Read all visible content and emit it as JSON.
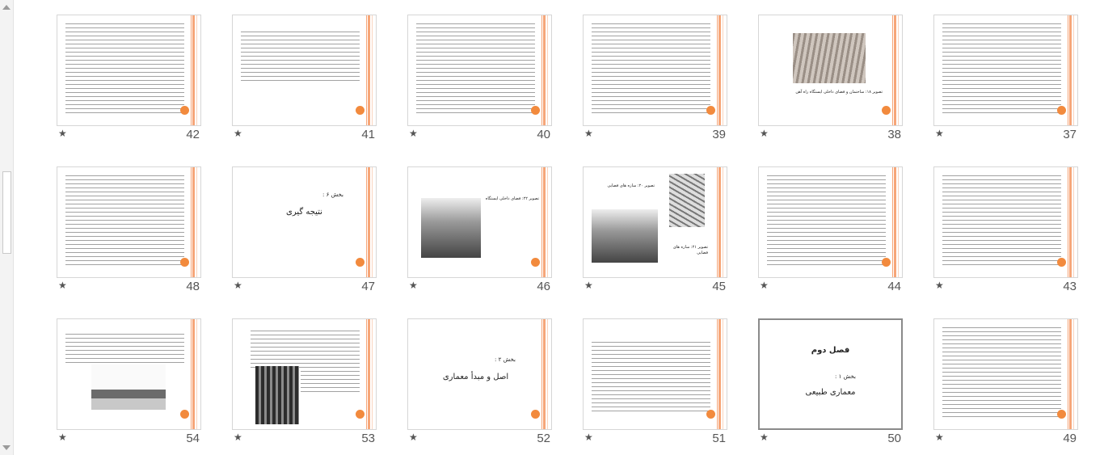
{
  "slides": [
    {
      "num": "37",
      "star": "★"
    },
    {
      "num": "38",
      "star": "★",
      "caption": "تصویر ۱۸: ساختمان و فضای داخلی ایستگاه راه آهن"
    },
    {
      "num": "39",
      "star": "★"
    },
    {
      "num": "40",
      "star": "★"
    },
    {
      "num": "41",
      "star": "★"
    },
    {
      "num": "42",
      "star": "★"
    },
    {
      "num": "43",
      "star": "★"
    },
    {
      "num": "44",
      "star": "★"
    },
    {
      "num": "45",
      "star": "★",
      "caption_top": "تصویر ۲۰: سازه های فضایی",
      "caption_bottom": "تصویر ۲۱: سازه های فضایی"
    },
    {
      "num": "46",
      "star": "★",
      "caption": "تصویر ۲۲: فضای داخلی ایستگاه"
    },
    {
      "num": "47",
      "star": "★",
      "label": "بخش ۶ :",
      "title": "نتیجه گیری"
    },
    {
      "num": "48",
      "star": "★"
    },
    {
      "num": "49",
      "star": "★"
    },
    {
      "num": "50",
      "star": "★",
      "chapter": "فصل دوم",
      "label": "بخش ۱ :",
      "title": "معماری طبیعی"
    },
    {
      "num": "51",
      "star": "★"
    },
    {
      "num": "52",
      "star": "★",
      "label": "بخش ۲ :",
      "title": "اصل و مبدأ معماری"
    },
    {
      "num": "53",
      "star": "★"
    },
    {
      "num": "54",
      "star": "★"
    }
  ]
}
